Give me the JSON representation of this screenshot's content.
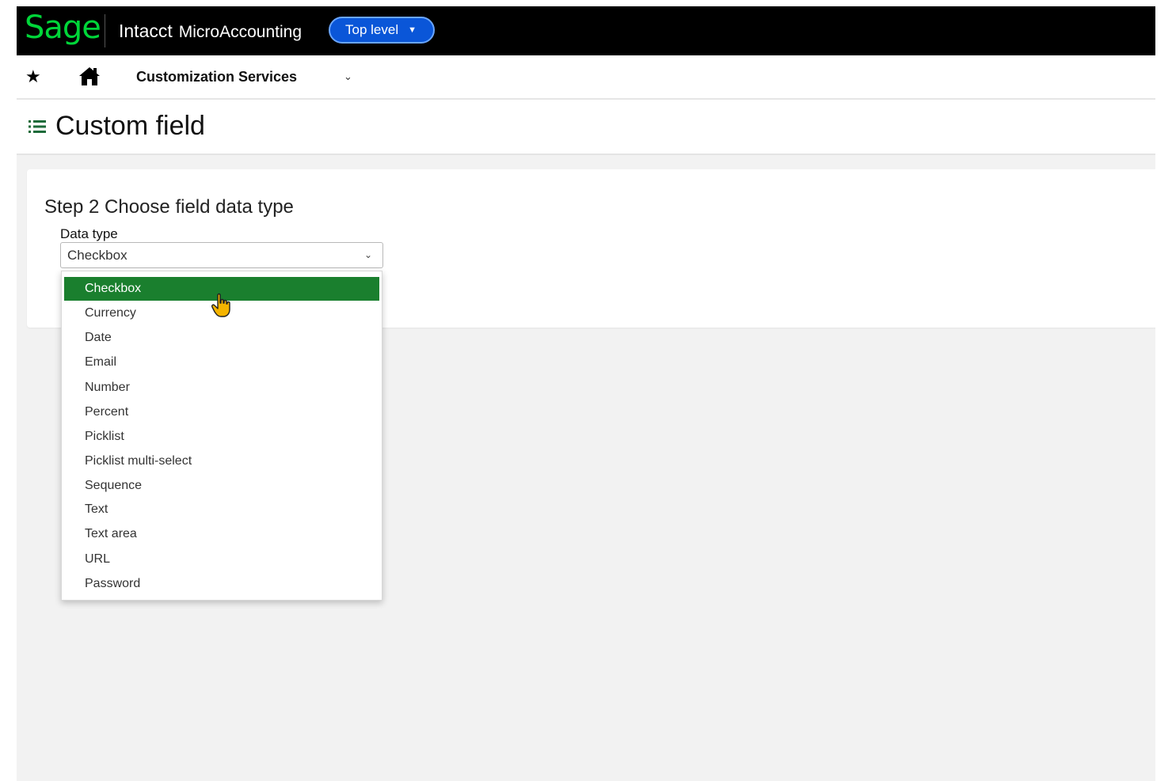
{
  "header": {
    "logo": "Sage",
    "product": "Intacct",
    "product_sub": "MicroAccounting",
    "level_button": "Top level",
    "colors": {
      "bar": "#000000",
      "logo": "#00d639",
      "level_button": "#0a56d8"
    }
  },
  "nav": {
    "favorites_icon": "star-icon",
    "home_icon": "home-icon",
    "module": "Customization Services"
  },
  "page": {
    "title": "Custom field",
    "menu_icon": "list-icon"
  },
  "form": {
    "step_heading": "Step 2 Choose field data type",
    "data_type_label": "Data type",
    "data_type_value": "Checkbox",
    "options": [
      "Checkbox",
      "Currency",
      "Date",
      "Email",
      "Number",
      "Percent",
      "Picklist",
      "Picklist multi-select",
      "Sequence",
      "Text",
      "Text area",
      "URL",
      "Password"
    ],
    "selected_index": 0,
    "selected_color": "#1a7f2e"
  }
}
